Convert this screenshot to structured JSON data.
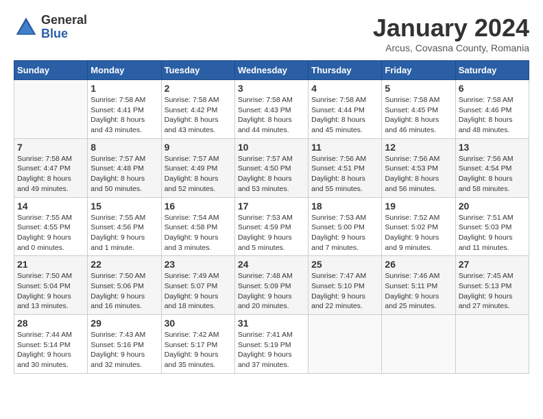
{
  "header": {
    "logo_general": "General",
    "logo_blue": "Blue",
    "month_title": "January 2024",
    "subtitle": "Arcus, Covasna County, Romania"
  },
  "days_of_week": [
    "Sunday",
    "Monday",
    "Tuesday",
    "Wednesday",
    "Thursday",
    "Friday",
    "Saturday"
  ],
  "weeks": [
    [
      {
        "day": "",
        "sunrise": "",
        "sunset": "",
        "daylight": ""
      },
      {
        "day": "1",
        "sunrise": "Sunrise: 7:58 AM",
        "sunset": "Sunset: 4:41 PM",
        "daylight": "Daylight: 8 hours and 43 minutes."
      },
      {
        "day": "2",
        "sunrise": "Sunrise: 7:58 AM",
        "sunset": "Sunset: 4:42 PM",
        "daylight": "Daylight: 8 hours and 43 minutes."
      },
      {
        "day": "3",
        "sunrise": "Sunrise: 7:58 AM",
        "sunset": "Sunset: 4:43 PM",
        "daylight": "Daylight: 8 hours and 44 minutes."
      },
      {
        "day": "4",
        "sunrise": "Sunrise: 7:58 AM",
        "sunset": "Sunset: 4:44 PM",
        "daylight": "Daylight: 8 hours and 45 minutes."
      },
      {
        "day": "5",
        "sunrise": "Sunrise: 7:58 AM",
        "sunset": "Sunset: 4:45 PM",
        "daylight": "Daylight: 8 hours and 46 minutes."
      },
      {
        "day": "6",
        "sunrise": "Sunrise: 7:58 AM",
        "sunset": "Sunset: 4:46 PM",
        "daylight": "Daylight: 8 hours and 48 minutes."
      }
    ],
    [
      {
        "day": "7",
        "sunrise": "Sunrise: 7:58 AM",
        "sunset": "Sunset: 4:47 PM",
        "daylight": "Daylight: 8 hours and 49 minutes."
      },
      {
        "day": "8",
        "sunrise": "Sunrise: 7:57 AM",
        "sunset": "Sunset: 4:48 PM",
        "daylight": "Daylight: 8 hours and 50 minutes."
      },
      {
        "day": "9",
        "sunrise": "Sunrise: 7:57 AM",
        "sunset": "Sunset: 4:49 PM",
        "daylight": "Daylight: 8 hours and 52 minutes."
      },
      {
        "day": "10",
        "sunrise": "Sunrise: 7:57 AM",
        "sunset": "Sunset: 4:50 PM",
        "daylight": "Daylight: 8 hours and 53 minutes."
      },
      {
        "day": "11",
        "sunrise": "Sunrise: 7:56 AM",
        "sunset": "Sunset: 4:51 PM",
        "daylight": "Daylight: 8 hours and 55 minutes."
      },
      {
        "day": "12",
        "sunrise": "Sunrise: 7:56 AM",
        "sunset": "Sunset: 4:53 PM",
        "daylight": "Daylight: 8 hours and 56 minutes."
      },
      {
        "day": "13",
        "sunrise": "Sunrise: 7:56 AM",
        "sunset": "Sunset: 4:54 PM",
        "daylight": "Daylight: 8 hours and 58 minutes."
      }
    ],
    [
      {
        "day": "14",
        "sunrise": "Sunrise: 7:55 AM",
        "sunset": "Sunset: 4:55 PM",
        "daylight": "Daylight: 9 hours and 0 minutes."
      },
      {
        "day": "15",
        "sunrise": "Sunrise: 7:55 AM",
        "sunset": "Sunset: 4:56 PM",
        "daylight": "Daylight: 9 hours and 1 minute."
      },
      {
        "day": "16",
        "sunrise": "Sunrise: 7:54 AM",
        "sunset": "Sunset: 4:58 PM",
        "daylight": "Daylight: 9 hours and 3 minutes."
      },
      {
        "day": "17",
        "sunrise": "Sunrise: 7:53 AM",
        "sunset": "Sunset: 4:59 PM",
        "daylight": "Daylight: 9 hours and 5 minutes."
      },
      {
        "day": "18",
        "sunrise": "Sunrise: 7:53 AM",
        "sunset": "Sunset: 5:00 PM",
        "daylight": "Daylight: 9 hours and 7 minutes."
      },
      {
        "day": "19",
        "sunrise": "Sunrise: 7:52 AM",
        "sunset": "Sunset: 5:02 PM",
        "daylight": "Daylight: 9 hours and 9 minutes."
      },
      {
        "day": "20",
        "sunrise": "Sunrise: 7:51 AM",
        "sunset": "Sunset: 5:03 PM",
        "daylight": "Daylight: 9 hours and 11 minutes."
      }
    ],
    [
      {
        "day": "21",
        "sunrise": "Sunrise: 7:50 AM",
        "sunset": "Sunset: 5:04 PM",
        "daylight": "Daylight: 9 hours and 13 minutes."
      },
      {
        "day": "22",
        "sunrise": "Sunrise: 7:50 AM",
        "sunset": "Sunset: 5:06 PM",
        "daylight": "Daylight: 9 hours and 16 minutes."
      },
      {
        "day": "23",
        "sunrise": "Sunrise: 7:49 AM",
        "sunset": "Sunset: 5:07 PM",
        "daylight": "Daylight: 9 hours and 18 minutes."
      },
      {
        "day": "24",
        "sunrise": "Sunrise: 7:48 AM",
        "sunset": "Sunset: 5:09 PM",
        "daylight": "Daylight: 9 hours and 20 minutes."
      },
      {
        "day": "25",
        "sunrise": "Sunrise: 7:47 AM",
        "sunset": "Sunset: 5:10 PM",
        "daylight": "Daylight: 9 hours and 22 minutes."
      },
      {
        "day": "26",
        "sunrise": "Sunrise: 7:46 AM",
        "sunset": "Sunset: 5:11 PM",
        "daylight": "Daylight: 9 hours and 25 minutes."
      },
      {
        "day": "27",
        "sunrise": "Sunrise: 7:45 AM",
        "sunset": "Sunset: 5:13 PM",
        "daylight": "Daylight: 9 hours and 27 minutes."
      }
    ],
    [
      {
        "day": "28",
        "sunrise": "Sunrise: 7:44 AM",
        "sunset": "Sunset: 5:14 PM",
        "daylight": "Daylight: 9 hours and 30 minutes."
      },
      {
        "day": "29",
        "sunrise": "Sunrise: 7:43 AM",
        "sunset": "Sunset: 5:16 PM",
        "daylight": "Daylight: 9 hours and 32 minutes."
      },
      {
        "day": "30",
        "sunrise": "Sunrise: 7:42 AM",
        "sunset": "Sunset: 5:17 PM",
        "daylight": "Daylight: 9 hours and 35 minutes."
      },
      {
        "day": "31",
        "sunrise": "Sunrise: 7:41 AM",
        "sunset": "Sunset: 5:19 PM",
        "daylight": "Daylight: 9 hours and 37 minutes."
      },
      {
        "day": "",
        "sunrise": "",
        "sunset": "",
        "daylight": ""
      },
      {
        "day": "",
        "sunrise": "",
        "sunset": "",
        "daylight": ""
      },
      {
        "day": "",
        "sunrise": "",
        "sunset": "",
        "daylight": ""
      }
    ]
  ]
}
